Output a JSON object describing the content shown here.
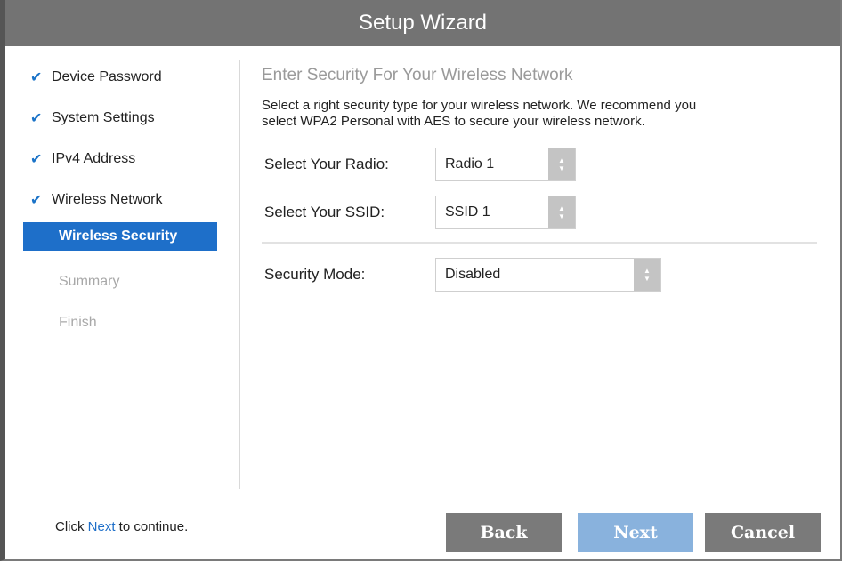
{
  "window": {
    "title": "Setup Wizard"
  },
  "sidebar": {
    "steps": [
      {
        "label": "Device Password",
        "state": "done"
      },
      {
        "label": "System Settings",
        "state": "done"
      },
      {
        "label": "IPv4 Address",
        "state": "done"
      },
      {
        "label": "Wireless Network",
        "state": "done"
      },
      {
        "label": "Wireless Security",
        "state": "active"
      },
      {
        "label": "Summary",
        "state": "pending"
      },
      {
        "label": "Finish",
        "state": "pending"
      }
    ],
    "check_glyph": "✔"
  },
  "main": {
    "title": "Enter Security For Your Wireless Network",
    "description_line1": "Select a right security type for your wireless network. We recommend you",
    "description_line2": "select WPA2 Personal with AES to secure your wireless network.",
    "radio": {
      "label": "Select Your Radio:",
      "value": "Radio 1"
    },
    "ssid": {
      "label": "Select Your SSID:",
      "value": "SSID 1"
    },
    "security_mode": {
      "label": "Security Mode:",
      "value": "Disabled"
    }
  },
  "footer": {
    "prefix": "Click ",
    "link": "Next",
    "suffix": " to continue.",
    "back_label": "Back",
    "next_label": "Next",
    "cancel_label": "Cancel"
  },
  "colors": {
    "accent": "#1e6fc9",
    "titlebar": "#737373",
    "next_button": "#89b2dd",
    "button": "#7a7a7a"
  },
  "icons": {
    "check": "check-icon",
    "spinner": "up-down-spinner-icon"
  }
}
